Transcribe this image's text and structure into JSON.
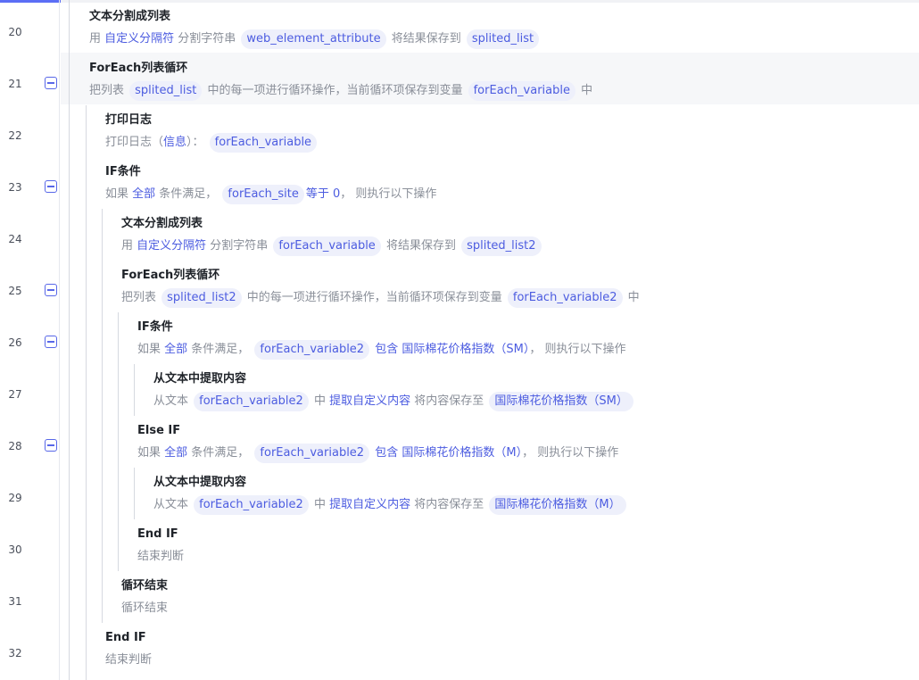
{
  "rows": [
    {
      "line": "20",
      "title": "文本分割成列表",
      "parts": [
        {
          "k": "t",
          "v": "用 "
        },
        {
          "k": "kw",
          "v": "自定义分隔符"
        },
        {
          "k": "t",
          "v": " 分割字符串 "
        },
        {
          "k": "tag",
          "v": "web_element_attribute"
        },
        {
          "k": "t",
          "v": " 将结果保存到 "
        },
        {
          "k": "tag",
          "v": "splited_list"
        }
      ]
    },
    {
      "line": "21",
      "title": "ForEach列表循环",
      "parts": [
        {
          "k": "t",
          "v": "把列表 "
        },
        {
          "k": "tag",
          "v": "splited_list"
        },
        {
          "k": "t",
          "v": " 中的每一项进行循环操作，当前循环项保存到变量 "
        },
        {
          "k": "tag",
          "v": "forEach_variable"
        },
        {
          "k": "t",
          "v": " 中"
        }
      ]
    },
    {
      "line": "22",
      "title": "打印日志",
      "parts": [
        {
          "k": "t",
          "v": "打印日志（"
        },
        {
          "k": "kw",
          "v": "信息"
        },
        {
          "k": "t",
          "v": "）： "
        },
        {
          "k": "tag",
          "v": "forEach_variable"
        }
      ]
    },
    {
      "line": "23",
      "title": "IF条件",
      "parts": [
        {
          "k": "t",
          "v": "如果 "
        },
        {
          "k": "kw",
          "v": "全部"
        },
        {
          "k": "t",
          "v": " 条件满足， "
        },
        {
          "k": "tag",
          "v": "forEach_site"
        },
        {
          "k": "kw",
          "v": "等于"
        },
        {
          "k": "kw",
          "v": " 0"
        },
        {
          "k": "t",
          "v": "， 则执行以下操作"
        }
      ]
    },
    {
      "line": "24",
      "title": "文本分割成列表",
      "parts": [
        {
          "k": "t",
          "v": "用 "
        },
        {
          "k": "kw",
          "v": "自定义分隔符"
        },
        {
          "k": "t",
          "v": " 分割字符串 "
        },
        {
          "k": "tag",
          "v": "forEach_variable"
        },
        {
          "k": "t",
          "v": " 将结果保存到 "
        },
        {
          "k": "tag",
          "v": "splited_list2"
        }
      ]
    },
    {
      "line": "25",
      "title": "ForEach列表循环",
      "parts": [
        {
          "k": "t",
          "v": "把列表 "
        },
        {
          "k": "tag",
          "v": "splited_list2"
        },
        {
          "k": "t",
          "v": " 中的每一项进行循环操作，当前循环项保存到变量 "
        },
        {
          "k": "tag",
          "v": "forEach_variable2"
        },
        {
          "k": "t",
          "v": " 中"
        }
      ]
    },
    {
      "line": "26",
      "title": "IF条件",
      "parts": [
        {
          "k": "t",
          "v": "如果 "
        },
        {
          "k": "kw",
          "v": "全部"
        },
        {
          "k": "t",
          "v": " 条件满足， "
        },
        {
          "k": "tag",
          "v": "forEach_variable2"
        },
        {
          "k": "kw",
          "v": " 包含 "
        },
        {
          "k": "kw",
          "v": "国际棉花价格指数（SM）"
        },
        {
          "k": "t",
          "v": "， 则执行以下操作"
        }
      ]
    },
    {
      "line": "27",
      "title": "从文本中提取内容",
      "parts": [
        {
          "k": "t",
          "v": "从文本 "
        },
        {
          "k": "tag",
          "v": "forEach_variable2"
        },
        {
          "k": "t",
          "v": " 中 "
        },
        {
          "k": "kw",
          "v": "提取自定义内容"
        },
        {
          "k": "t",
          "v": " 将内容保存至 "
        },
        {
          "k": "tag",
          "v": "国际棉花价格指数（SM）"
        }
      ]
    },
    {
      "line": "28",
      "title": "Else IF",
      "parts": [
        {
          "k": "t",
          "v": "如果 "
        },
        {
          "k": "kw",
          "v": "全部"
        },
        {
          "k": "t",
          "v": " 条件满足， "
        },
        {
          "k": "tag",
          "v": "forEach_variable2"
        },
        {
          "k": "kw",
          "v": " 包含 "
        },
        {
          "k": "kw",
          "v": "国际棉花价格指数（M）"
        },
        {
          "k": "t",
          "v": "， 则执行以下操作"
        }
      ]
    },
    {
      "line": "29",
      "title": "从文本中提取内容",
      "parts": [
        {
          "k": "t",
          "v": "从文本 "
        },
        {
          "k": "tag",
          "v": "forEach_variable2"
        },
        {
          "k": "t",
          "v": " 中 "
        },
        {
          "k": "kw",
          "v": "提取自定义内容"
        },
        {
          "k": "t",
          "v": " 将内容保存至 "
        },
        {
          "k": "tag",
          "v": "国际棉花价格指数（M）"
        }
      ]
    },
    {
      "line": "30",
      "title": "End IF",
      "parts": [
        {
          "k": "t",
          "v": "结束判断"
        }
      ]
    },
    {
      "line": "31",
      "title": "循环结束",
      "parts": [
        {
          "k": "t",
          "v": "循环结束"
        }
      ]
    },
    {
      "line": "32",
      "title": "End IF",
      "parts": [
        {
          "k": "t",
          "v": "结束判断"
        }
      ]
    }
  ],
  "colors": {
    "accent": "#5b6ef5",
    "tag_bg": "#eef0fb",
    "keyword": "#4c5ce0"
  }
}
